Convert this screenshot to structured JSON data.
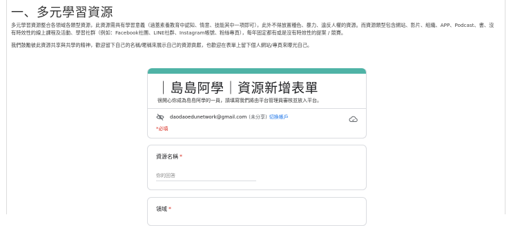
{
  "page": {
    "title": "一、多元學習資源",
    "paragraph1": "多元學習資源整合各領域各類型資源，此資源需具有學習意義（涵蓋素養教育中認知、情意、技能其中一項即可），此外不得放置種色、暴力、違反人權的資源。而資源類型包含網站、影片、組織、APP、Podcast、書、沒有時效性的線上課程及活動、學習社群（例如：Facebook社團、LINE社群、Instagram帳號、粉絲專頁），每年固定都有或是沒有時效性的提案 / 競賽。",
    "paragraph2": "我們鼓勵彼此資源共享與共學的精神，歡迎留下自己的名稱/暱稱來展示自己的資源貢獻，也歡迎在表單上留下個人網站/專頁來曝光自己。"
  },
  "form": {
    "accent_color": "#4fb3a6",
    "title": "｜島島阿學｜資源新增表單",
    "description": "很開心你成為島島阿學的一員，請填寫我們將由平台管理員審核並放入平台。",
    "account": {
      "email": "daodaoedunetwork@gmail.com",
      "unsaved": "(未分享)",
      "switch_label": "切換帳戶"
    },
    "required_note": "*必填",
    "questions": [
      {
        "label": "資源名稱",
        "required_mark": "*",
        "placeholder": "你的回答"
      },
      {
        "label": "領域",
        "required_mark": "*"
      }
    ]
  }
}
